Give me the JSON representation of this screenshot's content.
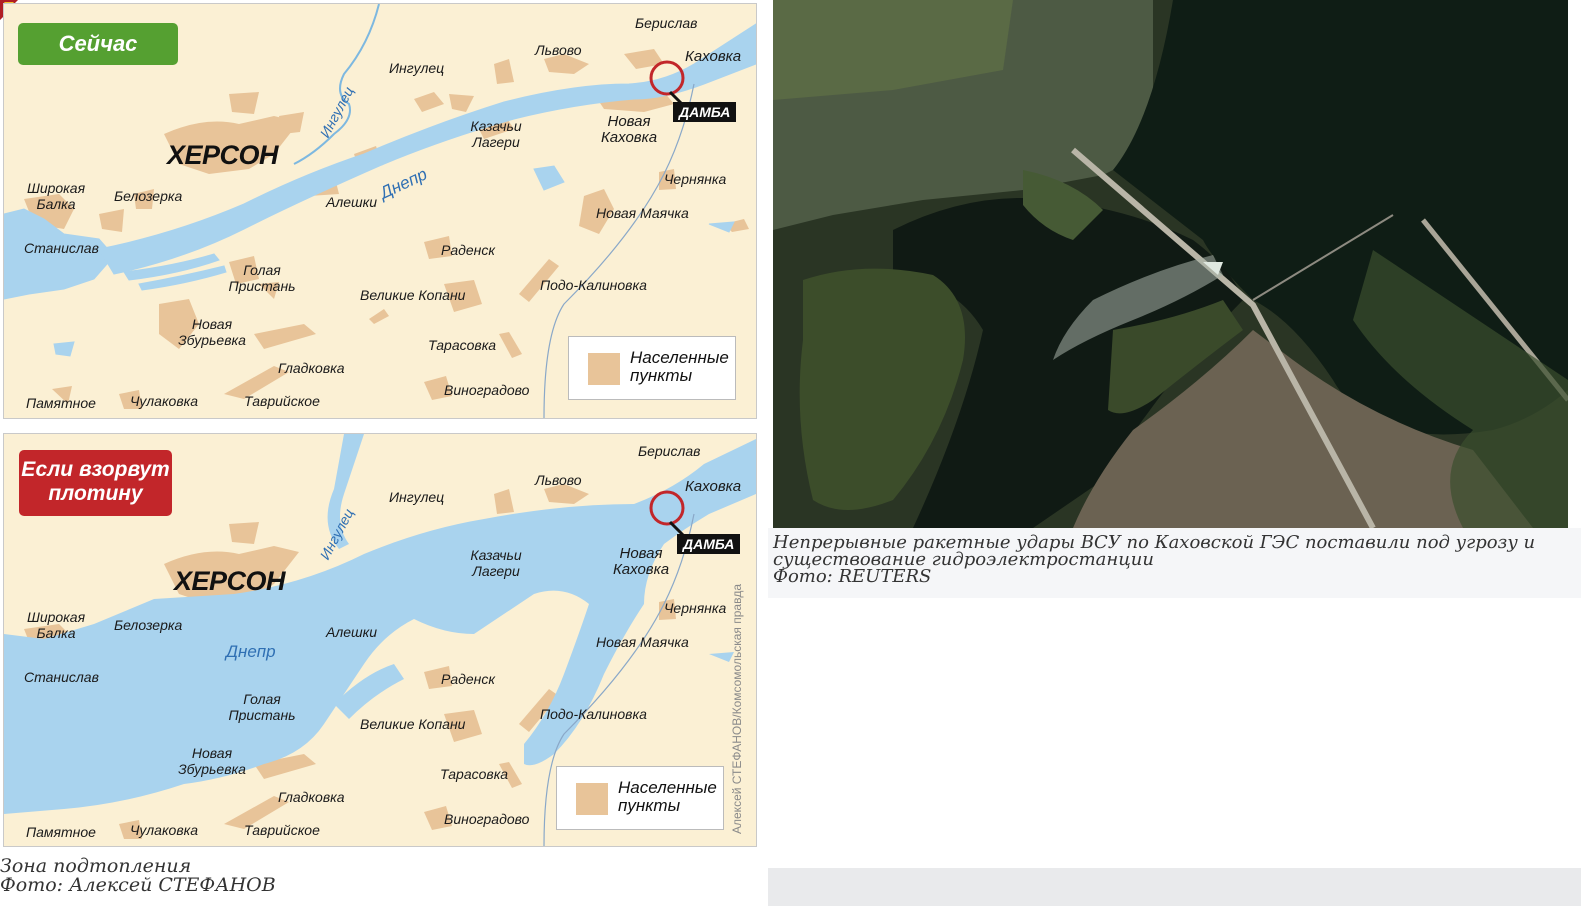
{
  "map_now": {
    "badge": "Сейчас",
    "city": "ХЕРСОН",
    "river_dnepr": "Днепр",
    "river_ingulets": "Ингулец",
    "dam": "ДАМБА",
    "legend": [
      "Населенные",
      "пункты"
    ],
    "places": {
      "berislav": "Берислав",
      "kakhovka": "Каховка",
      "lvovo": "Львово",
      "ingulets": "Ингулец",
      "nova_kakhovka": "Новая Каховка",
      "kazachi": "Казачьи Лагери",
      "chernyanka": "Чернянка",
      "shirokaya": "Широкая Балка",
      "belozerka": "Белозерка",
      "aleshki": "Алешки",
      "novaya_mayachka": "Новая Маячка",
      "stanislav": "Станислав",
      "radensk": "Раденск",
      "golaya": "Голая Пристань",
      "podo": "Подо-Калиновка",
      "kopani": "Великие Копани",
      "zburyevka": "Новая Збурьевка",
      "tarasovka": "Тарасовка",
      "gladkovka": "Гладковка",
      "vinogradovo": "Виноградово",
      "pamyatnoe": "Памятное",
      "chulakovka": "Чулаковка",
      "tavriyskoe": "Таврийское"
    }
  },
  "map_if": {
    "badge": "Если взорвут плотину",
    "city": "ХЕРСОН",
    "river_dnepr": "Днепр",
    "river_ingulets": "Ингулец",
    "dam": "ДАМБА",
    "legend": [
      "Населенные",
      "пункты"
    ],
    "credit": "Алексей СТЕФАНОВ/Комсомольская правда"
  },
  "captions": {
    "left_line1": "Зона подтопления",
    "left_line2": "Фото: Алексей СТЕФАНОВ",
    "right_line1": "Непрерывные ракетные удары ВСУ по Каховской ГЭС поставили под угрозу и",
    "right_line2": "существование гидроэлектростанции",
    "right_line3": "Фото: REUTERS"
  },
  "colors": {
    "land": "#fbf0d4",
    "water": "#a9d3ee",
    "settlement": "#e8c499",
    "badge_green": "#55a031",
    "badge_red": "#c2262a"
  }
}
